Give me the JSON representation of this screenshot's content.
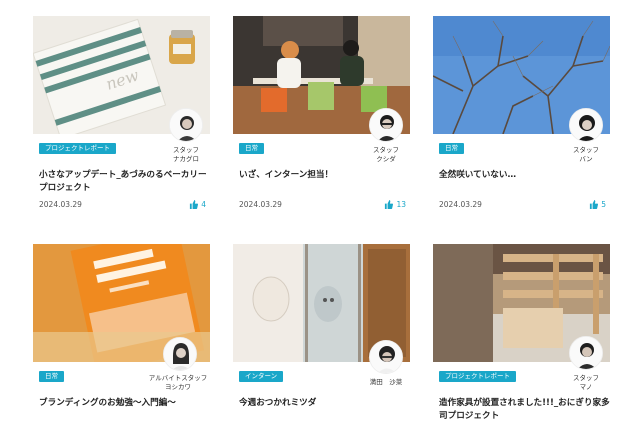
{
  "colors": {
    "accent": "#1aa7c9",
    "text": "#222222",
    "muted": "#555555"
  },
  "cards": [
    {
      "badge": "プロジェクトレポート",
      "title": "小さなアップデート_あづみのるベーカリープロジェクト",
      "date": "2024.03.29",
      "likes": "4",
      "author_role": "スタッフ",
      "author_name": "ナカグロ",
      "image": "bread-bags-and-honey-jar"
    },
    {
      "badge": "日常",
      "title": "いざ、インターン担当！",
      "date": "2024.03.29",
      "likes": "13",
      "author_role": "スタッフ",
      "author_name": "クシダ",
      "image": "two-people-at-table"
    },
    {
      "badge": "日常",
      "title": "全然咲いていない…",
      "date": "2024.03.29",
      "likes": "5",
      "author_role": "スタッフ",
      "author_name": "バン",
      "image": "bare-tree-blue-sky"
    },
    {
      "badge": "日常",
      "title": "ブランディングのお勉強〜入門編〜",
      "date": "",
      "likes": "",
      "author_role": "アルバイトスタッフ",
      "author_name": "ヨシカワ",
      "image": "branding-book"
    },
    {
      "badge": "インターン",
      "title": "今週おつかれミツダ",
      "date": "",
      "likes": "",
      "author_role": "",
      "author_name": "満田　沙菜",
      "image": "glass-door-character"
    },
    {
      "badge": "プロジェクトレポート",
      "title": "造作家具が設置されました!!!_おにぎり家多司プロジェクト",
      "date": "",
      "likes": "",
      "author_role": "スタッフ",
      "author_name": "マノ",
      "image": "wooden-shelves-room"
    }
  ]
}
